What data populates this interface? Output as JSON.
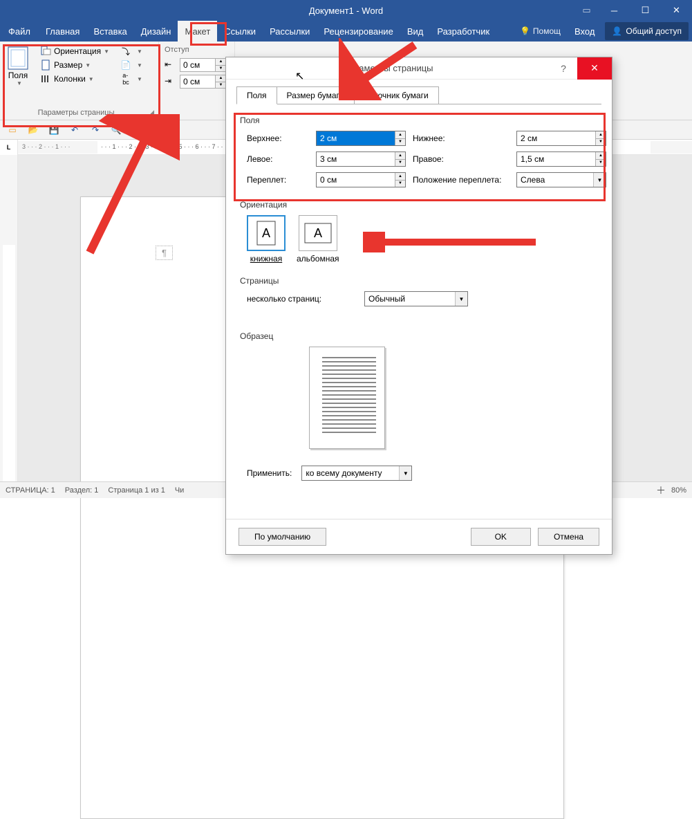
{
  "titlebar": {
    "title": "Документ1 - Word"
  },
  "ribbon": {
    "tabs": [
      "Файл",
      "Главная",
      "Вставка",
      "Дизайн",
      "Макет",
      "Ссылки",
      "Рассылки",
      "Рецензирование",
      "Вид",
      "Разработчик"
    ],
    "active_tab": "Макет",
    "help": "Помощ",
    "signin": "Вход",
    "share": "Общий доступ"
  },
  "page_setup_group": {
    "title": "Параметры страницы",
    "fields": "Поля",
    "orientation": "Ориентация",
    "size": "Размер",
    "columns": "Колонки"
  },
  "indent_group": {
    "title": "Отступ",
    "left_val": "0 см",
    "right_val": "0 см"
  },
  "statusbar": {
    "page": "СТРАНИЦА: 1",
    "section": "Раздел: 1",
    "pageof": "Страница 1 из 1",
    "words_short": "Чи",
    "zoom": "80%"
  },
  "dialog": {
    "title": "Параметры страницы",
    "tabs": [
      "Поля",
      "Размер бумаги",
      "Источник бумаги"
    ],
    "active_tab": "Поля",
    "section_fields": "Поля",
    "top_lbl": "Верхнее:",
    "top_val": "2 см",
    "bottom_lbl": "Нижнее:",
    "bottom_val": "2 см",
    "left_lbl": "Левое:",
    "left_val": "3 см",
    "right_lbl": "Правое:",
    "right_val": "1,5 см",
    "gutter_lbl": "Переплет:",
    "gutter_val": "0 см",
    "gutterpos_lbl": "Положение переплета:",
    "gutterpos_val": "Слева",
    "section_orient": "Ориентация",
    "orient_portrait": "книжная",
    "orient_landscape": "альбомная",
    "section_pages": "Страницы",
    "multi_lbl": "несколько страниц:",
    "multi_val": "Обычный",
    "section_preview": "Образец",
    "apply_lbl": "Применить:",
    "apply_val": "ко всему документу",
    "default_btn": "По умолчанию",
    "ok_btn": "OK",
    "cancel_btn": "Отмена"
  }
}
